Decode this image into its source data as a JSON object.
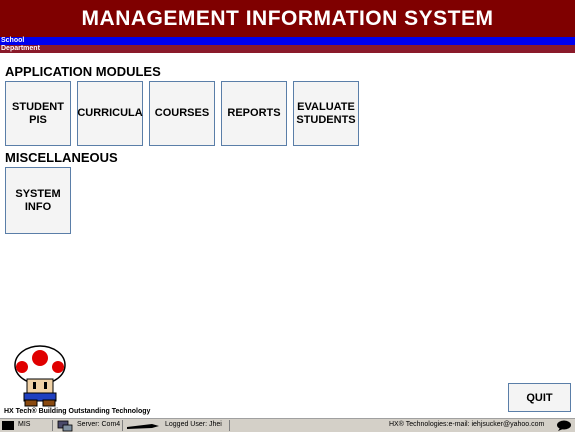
{
  "header": {
    "title": "MANAGEMENT INFORMATION SYSTEM",
    "school_label": "School",
    "department_label": "Department",
    "title_bg": "#7f0000",
    "school_bar_color": "#0000ee",
    "department_bar_color": "#8a1a2a"
  },
  "sections": {
    "application_modules": "APPLICATION MODULES",
    "miscellaneous": "MISCELLANEOUS"
  },
  "modules": [
    {
      "label": "STUDENT\nPIS"
    },
    {
      "label": "CURRICULA"
    },
    {
      "label": "COURSES"
    },
    {
      "label": "REPORTS"
    },
    {
      "label": "EVALUATE\nSTUDENTS"
    }
  ],
  "misc": {
    "system_info": "SYSTEM\nINFO"
  },
  "footer": {
    "caption": "HX Tech® Building Outstanding Technology",
    "quit_label": "QUIT"
  },
  "status_bar": {
    "app": "MIS",
    "server": "Server: Com4",
    "user": "Logged User: Jhei",
    "company": "HX® Technologies:e-mail: iehjsucker@yahoo.com"
  },
  "icons": {
    "app_icon": "terminal-icon",
    "server_icon": "server-icon",
    "user_icon": "pen-icon",
    "mascot": "toad-mushroom-icon",
    "chat_icon": "speech-bubble-icon"
  }
}
